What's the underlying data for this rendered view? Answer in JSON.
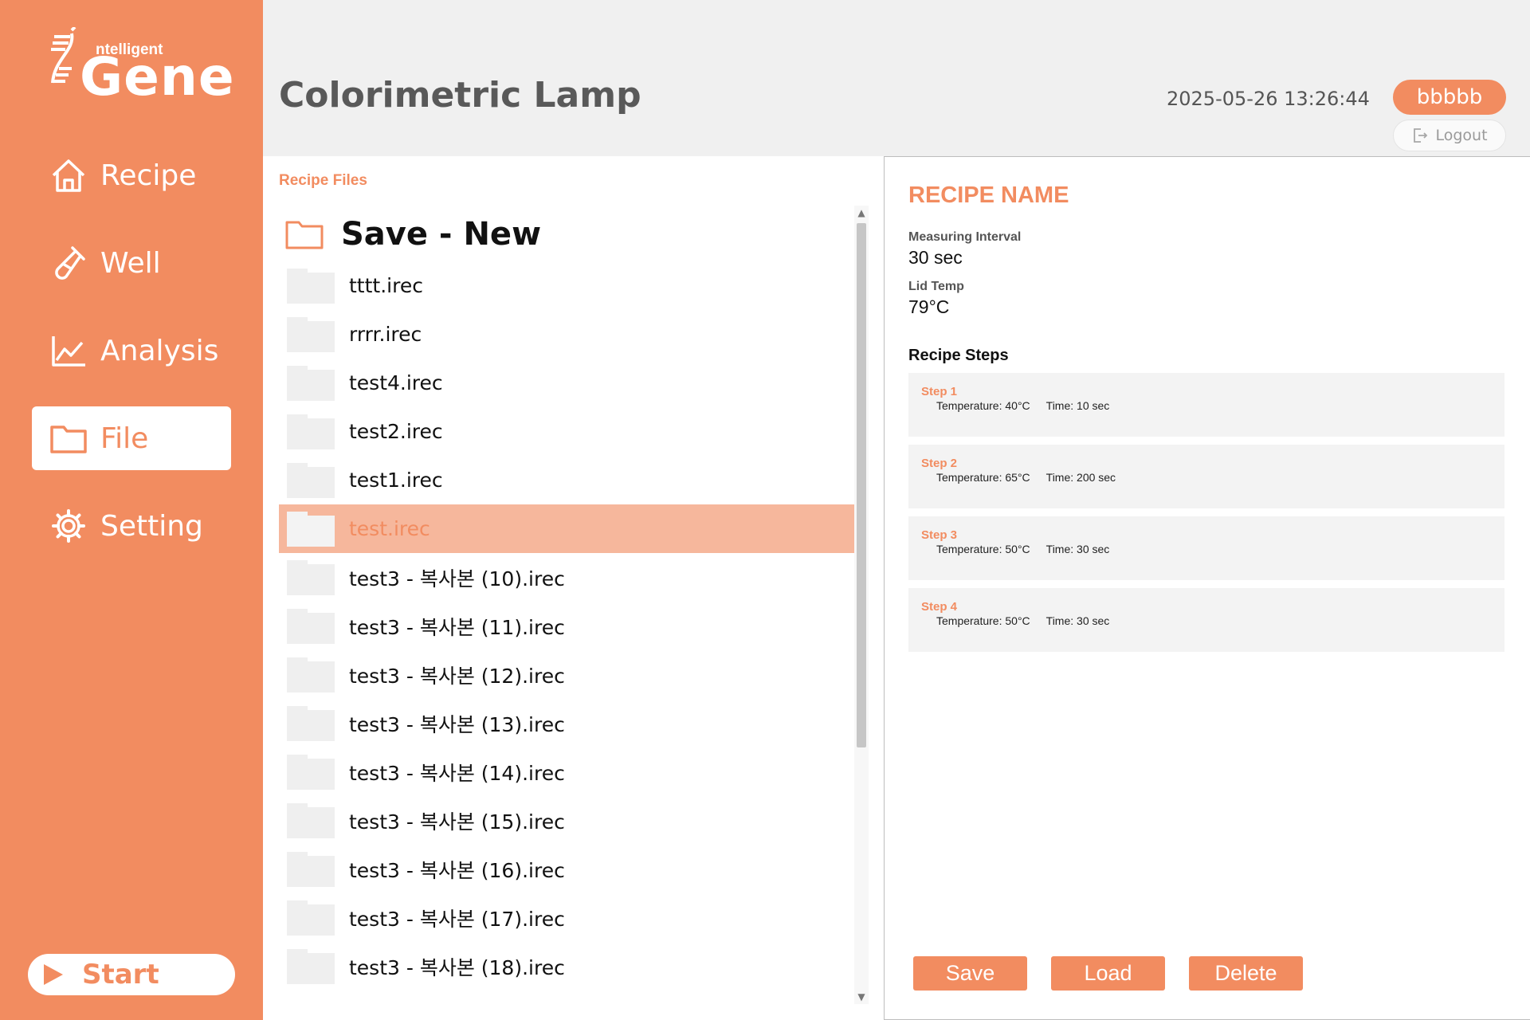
{
  "brand": {
    "logo_small": "ntelligent",
    "logo_big": "Gene"
  },
  "sidebar": {
    "items": [
      {
        "label": "Recipe",
        "icon": "home-icon",
        "active": false
      },
      {
        "label": "Well",
        "icon": "test-tube-icon",
        "active": false
      },
      {
        "label": "Analysis",
        "icon": "line-chart-icon",
        "active": false
      },
      {
        "label": "File",
        "icon": "folder-icon",
        "active": true
      },
      {
        "label": "Setting",
        "icon": "gear-icon",
        "active": false
      }
    ],
    "start_label": "Start"
  },
  "header": {
    "title": "Colorimetric Lamp",
    "datetime": "2025-05-26 13:26:44",
    "user": "bbbbb",
    "logout_label": "Logout"
  },
  "files": {
    "section_label": "Recipe Files",
    "save_new_label": "Save - New",
    "items": [
      {
        "name": "tttt.irec"
      },
      {
        "name": "rrrr.irec"
      },
      {
        "name": "test4.irec"
      },
      {
        "name": "test2.irec"
      },
      {
        "name": "test1.irec"
      },
      {
        "name": "test.irec",
        "selected": true
      },
      {
        "name": "test3 - 복사본 (10).irec"
      },
      {
        "name": "test3 - 복사본 (11).irec"
      },
      {
        "name": "test3 - 복사본 (12).irec"
      },
      {
        "name": "test3 - 복사본 (13).irec"
      },
      {
        "name": "test3 - 복사본 (14).irec"
      },
      {
        "name": "test3 - 복사본 (15).irec"
      },
      {
        "name": "test3 - 복사본 (16).irec"
      },
      {
        "name": "test3 - 복사본 (17).irec"
      },
      {
        "name": "test3 - 복사본 (18).irec"
      }
    ]
  },
  "detail": {
    "recipe_name": "RECIPE NAME",
    "interval_label": "Measuring Interval",
    "interval_value": "30 sec",
    "lid_label": "Lid Temp",
    "lid_value": "79°C",
    "steps_title": "Recipe Steps",
    "steps": [
      {
        "label": "Step 1",
        "temperature": "Temperature: 40°C",
        "time": "Time: 10 sec"
      },
      {
        "label": "Step 2",
        "temperature": "Temperature: 65°C",
        "time": "Time: 200 sec"
      },
      {
        "label": "Step 3",
        "temperature": "Temperature: 50°C",
        "time": "Time: 30 sec"
      },
      {
        "label": "Step 4",
        "temperature": "Temperature: 50°C",
        "time": "Time: 30 sec"
      }
    ],
    "save_label": "Save",
    "load_label": "Load",
    "delete_label": "Delete"
  },
  "colors": {
    "accent": "#f28c60",
    "selected_row": "#f6b79c",
    "header_bg": "#f0f0f0"
  }
}
